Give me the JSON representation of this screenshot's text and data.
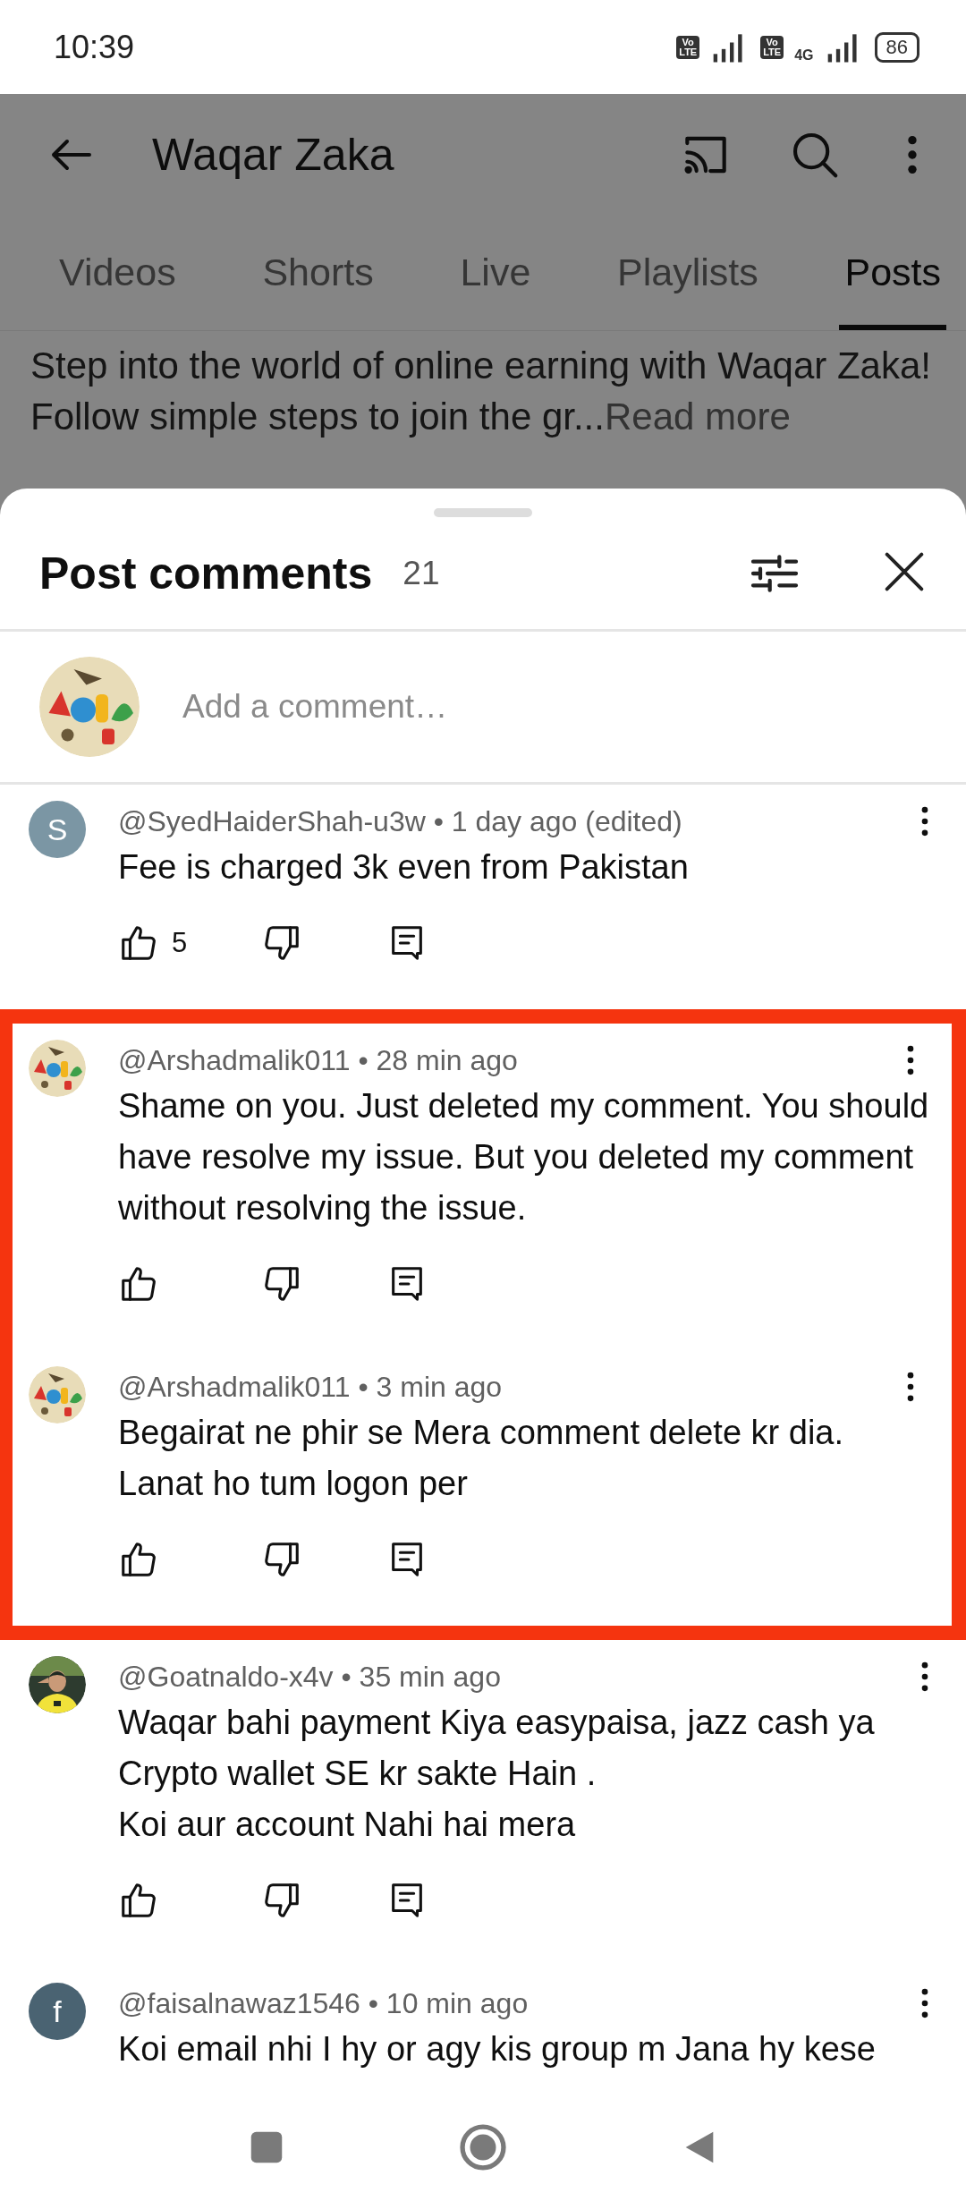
{
  "status_bar": {
    "time": "10:39",
    "sim_badges": [
      {
        "top": "Vo",
        "bottom": "LTE"
      },
      {
        "top": "Vo",
        "bottom": "LTE"
      }
    ],
    "network": "4G",
    "battery": "86"
  },
  "top_bar": {
    "title": "Waqar Zaka"
  },
  "tabs": [
    {
      "label": "Videos",
      "selected": false
    },
    {
      "label": "Shorts",
      "selected": false
    },
    {
      "label": "Live",
      "selected": false
    },
    {
      "label": "Playlists",
      "selected": false
    },
    {
      "label": "Posts",
      "selected": true
    }
  ],
  "post": {
    "text": "Step into the world of online earning with Waqar Zaka! Follow simple steps to join the gr...",
    "read_more": "Read more"
  },
  "comments_sheet": {
    "title": "Post comments",
    "count": "21",
    "add_comment": {
      "placeholder": "Add a comment…"
    },
    "comments": [
      {
        "avatar": {
          "kind": "letter",
          "letter": "S",
          "color": "#7b96a4"
        },
        "meta": "@SyedHaiderShah-u3w • 1 day ago (edited)",
        "body": "Fee is charged 3k even from Pakistan",
        "likes": "5",
        "highlighted": false
      },
      {
        "meta": "@Arshadmalik011 • 28 min ago",
        "body": "Shame on you. Just deleted my comment. You should have resolve my issue. But you deleted my comment without resolving the issue.",
        "highlighted": true
      },
      {
        "meta": "@Arshadmalik011 • 3 min ago",
        "body": "Begairat ne phir se Mera comment delete kr dia. Lanat ho tum logon per",
        "highlighted": true
      },
      {
        "meta": "@Goatnaldo-x4v • 35 min ago",
        "body": "Waqar bahi payment Kiya easypaisa, jazz cash ya Crypto wallet SE kr sakte Hain .\nKoi aur account Nahi hai mera",
        "highlighted": false
      },
      {
        "avatar": {
          "kind": "letter",
          "letter": "f",
          "color": "#4a6372"
        },
        "meta": "@faisalnawaz1546 • 10 min ago",
        "body": "Koi email nhi I hy or agy kis group m Jana hy kese",
        "highlighted": false
      }
    ]
  }
}
